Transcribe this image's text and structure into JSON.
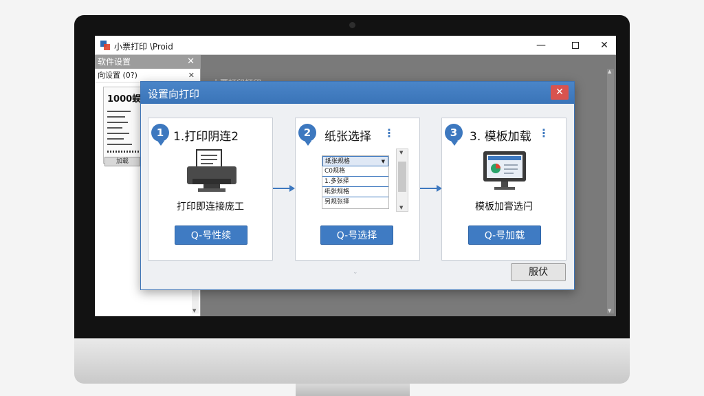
{
  "window": {
    "title": "小票打印 \\Proid",
    "minimize": "—",
    "close": "✕"
  },
  "left_panel": {
    "header": "软件设置",
    "header_close": "✕",
    "subheader": "向设置 (0?)",
    "subheader_close": "✕",
    "card_title": "1000蜈",
    "card_button": "加载"
  },
  "background": {
    "title": "小票打印打印"
  },
  "dialog": {
    "title": "设置向打印",
    "close": "✕",
    "footer_button": "服伏",
    "hint_glyph": "⌄",
    "steps": [
      {
        "number": "1",
        "title": "1.打印阴连2",
        "caption": "打印即连接庞工",
        "button": "Q-号性续",
        "icon": "printer-icon"
      },
      {
        "number": "2",
        "title": "纸张选择",
        "caption": "",
        "button": "Q-号选择",
        "icon": "paper-list",
        "paper_options": [
          "纸张规格",
          "C0规格",
          "1.多张择",
          "纸张规格",
          "另规张择"
        ],
        "selected_index": 0
      },
      {
        "number": "3",
        "title": "3. 模板加载",
        "caption": "模板加膏选闩",
        "button": "Q-号加载",
        "icon": "template-monitor-icon"
      }
    ]
  },
  "colors": {
    "accent": "#3d78bf",
    "close_red": "#d9534f",
    "dialog_bg": "#eef0f3"
  }
}
